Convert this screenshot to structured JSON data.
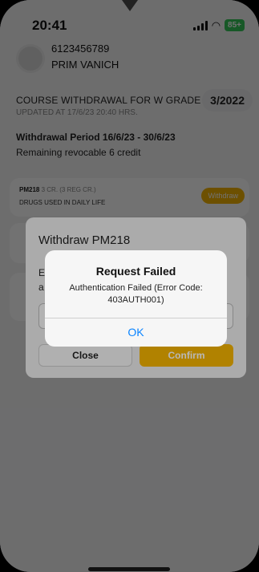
{
  "status_bar": {
    "time": "20:41",
    "battery": "85+"
  },
  "profile": {
    "student_id": "6123456789",
    "name": "PRIM VANICH"
  },
  "course": {
    "title": "COURSE WITHDRAWAL FOR W GRADE",
    "updated": "UPDATED AT 17/6/23 20:40 HRS.",
    "term": "3/2022",
    "period": "Withdrawal Period 16/6/23 - 30/6/23",
    "revocable": "Remaining revocable 6 credit"
  },
  "courses": [
    {
      "code": "PM218",
      "credits": "3 CR. (3 REG CR.)",
      "name": "DRUGS USED IN DAILY LIFE",
      "action": "Withdraw"
    }
  ],
  "dialog": {
    "title": "Withdraw PM218",
    "close_label": "Close",
    "confirm_label": "Confirm"
  },
  "alert": {
    "title": "Request Failed",
    "message": "Authentication Failed (Error Code: 403AUTH001)",
    "ok_label": "OK"
  }
}
